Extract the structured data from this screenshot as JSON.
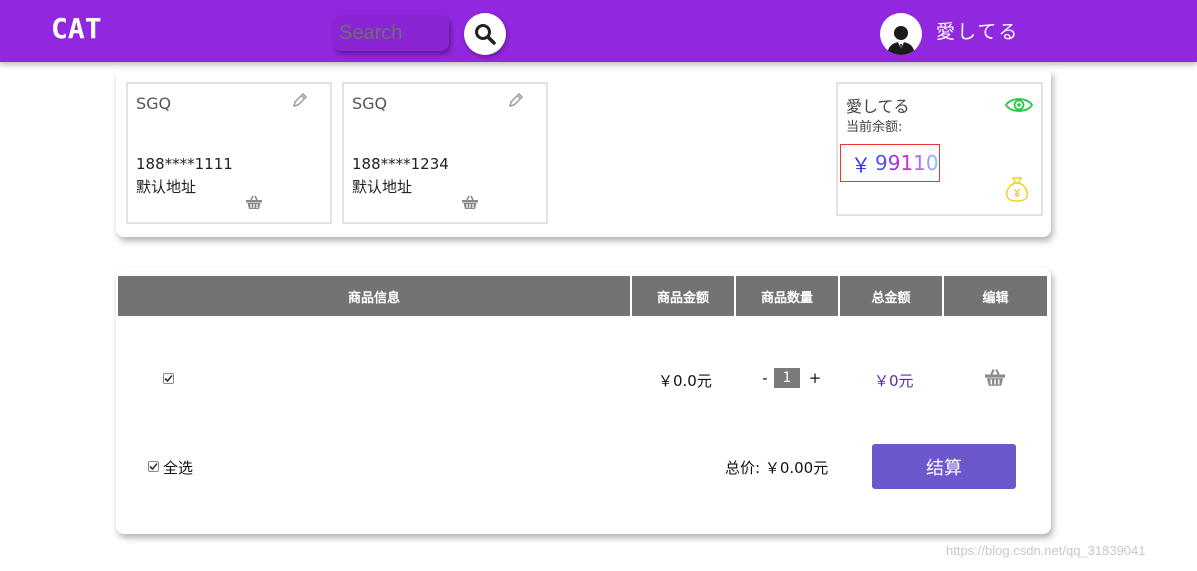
{
  "header": {
    "brand": "CAT",
    "search_placeholder": "Search",
    "username": "愛してる",
    "accent": "#9227e0"
  },
  "addresses": [
    {
      "name": "SGQ",
      "phone": "188****1111",
      "tag": "默认地址"
    },
    {
      "name": "SGQ",
      "phone": "188****1234",
      "tag": "默认地址"
    }
  ],
  "balance": {
    "name": "愛してる",
    "label": "当前余额:",
    "currency": "￥",
    "amount": "99110"
  },
  "cart": {
    "columns": [
      "商品信息",
      "商品金额",
      "商品数量",
      "总金额",
      "编辑"
    ],
    "items": [
      {
        "checked": true,
        "price": "￥0.0元",
        "qty_minus": "-",
        "quantity": "1",
        "qty_plus": "+",
        "total": "￥0元"
      }
    ],
    "select_all": "全选",
    "total_label": "总价: ￥0.00元",
    "checkout": "结算"
  },
  "icons": {
    "search": "search-icon",
    "avatar": "user-avatar-icon",
    "edit": "pencil-icon",
    "delete": "basket-icon",
    "eye": "eye-icon",
    "money_bag": "money-bag-icon"
  },
  "colors": {
    "header_bg": "#9227e0",
    "checkout_bg": "#6c57cc",
    "eye": "#22cc44",
    "money_bag": "#f0d020",
    "total_text": "#5d2bb3"
  },
  "watermark": "https://blog.csdn.net/qq_31839041"
}
